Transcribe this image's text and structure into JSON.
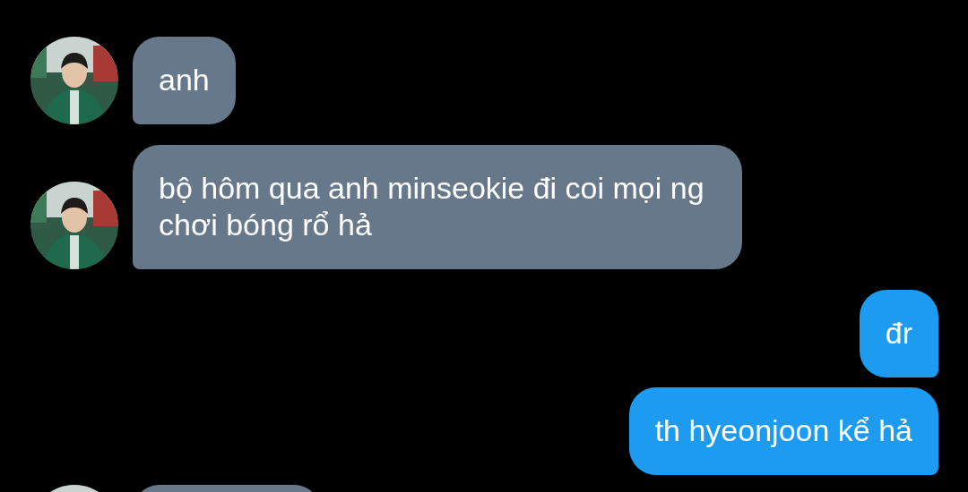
{
  "messages": [
    {
      "kind": "incoming",
      "text": "anh"
    },
    {
      "kind": "incoming",
      "text": "bộ hôm qua anh minseokie đi coi mọi ng chơi bóng rổ hả"
    },
    {
      "kind": "outgoing",
      "text": "đr"
    },
    {
      "kind": "outgoing",
      "text": "th hyeonjoon kể hả"
    },
    {
      "kind": "incoming"
    }
  ]
}
